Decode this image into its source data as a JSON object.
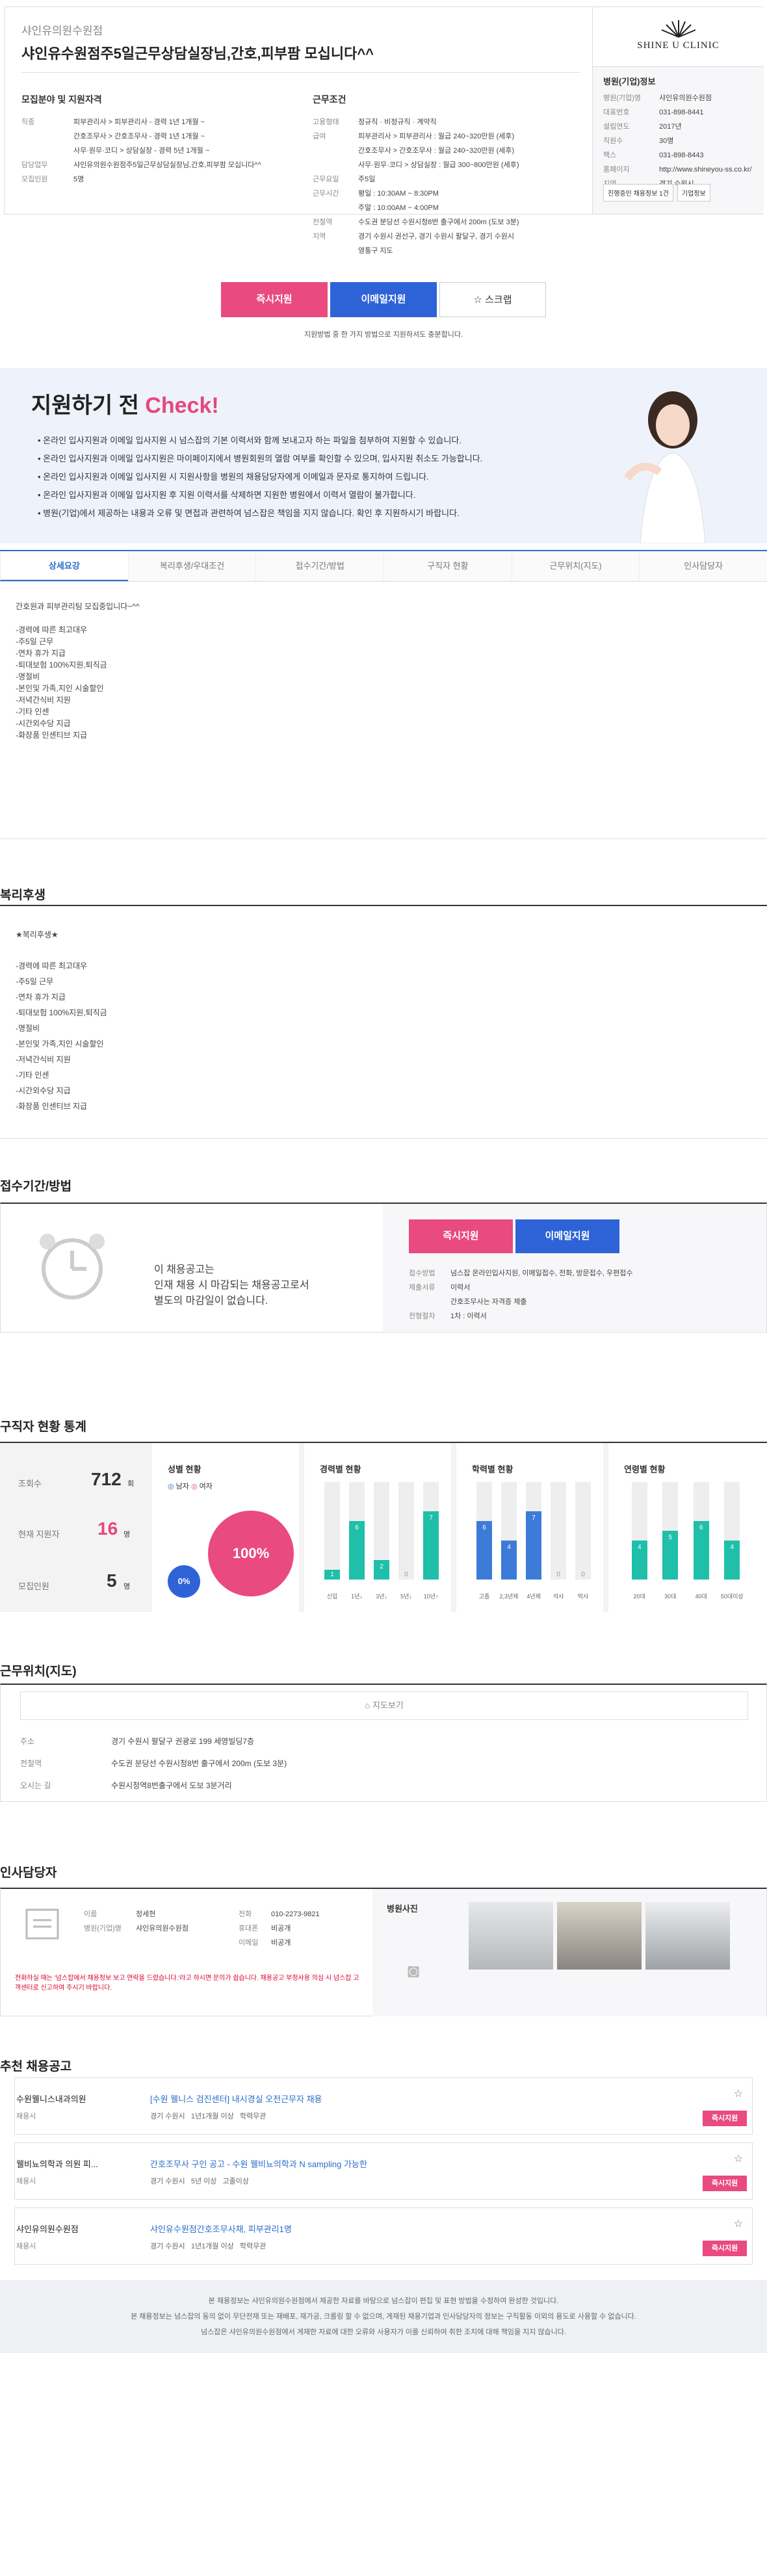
{
  "header": {
    "company": "샤인유의원수원점",
    "title": "샤인유수원점주5일근무상담실장님,간호,피부팜 모십니다^^"
  },
  "left": {
    "heading": "모집분야 및 지원자격",
    "rows": [
      {
        "k": "직종",
        "v": "피부관리사 > 피부관리사 - 경력 1년 1개월 ~"
      },
      {
        "k": "",
        "v": "간호조무사 > 간호조무사 - 경력 1년 1개월 ~"
      },
      {
        "k": "",
        "v": "사무·원무·코디 > 상담실장 - 경력 5년 1개월 ~"
      },
      {
        "k": "담당업무",
        "v": "샤인유의원수원점주5일근무상담실장님,간호,피부팜 모십니다^^"
      },
      {
        "k": "모집인원",
        "v": "5명"
      }
    ]
  },
  "right": {
    "heading": "근무조건",
    "rows": [
      {
        "k": "고용형태",
        "v": "정규직 · 비정규직 · 계약직"
      },
      {
        "k": "급여",
        "v": "피부관리사 > 피부관리사 : 월급 240~320만원 (세후)"
      },
      {
        "k": "",
        "v": "간호조무사 > 간호조무사 : 월급 240~320만원 (세후)"
      },
      {
        "k": "",
        "v": "사무·원무·코디 > 상담실장 : 월급 300~800만원 (세후)"
      },
      {
        "k": "근무요일",
        "v": "주5일"
      },
      {
        "k": "근무시간",
        "v": "평일 : 10:30AM ~ 8:30PM"
      },
      {
        "k": "",
        "v": "주말 : 10:00AM ~ 4:00PM"
      },
      {
        "k": "전철역",
        "v": "수도권 분당선 수원시청8번 출구에서 200m (도보 3분)"
      },
      {
        "k": "지역",
        "v": "경기 수원시 권선구, 경기 수원시 팔달구, 경기 수원시"
      },
      {
        "k": "",
        "v": "영통구  지도"
      }
    ]
  },
  "side": {
    "logo": "SHINE U CLINIC",
    "heading": "병원(기업)정보",
    "rows": [
      {
        "k": "병원(기업)명",
        "v": "샤인유의원수원점"
      },
      {
        "k": "대표번호",
        "v": "031-898-8441"
      },
      {
        "k": "설립연도",
        "v": "2017년"
      },
      {
        "k": "직원수",
        "v": "30명"
      },
      {
        "k": "팩스",
        "v": "031-898-8443"
      },
      {
        "k": "홈페이지",
        "v": "http://www.shineyou-ss.co.kr/"
      },
      {
        "k": "지역",
        "v": "경기 수원시"
      }
    ],
    "btn1": "진행중인 채용정보 1건",
    "btn2": "기업정보"
  },
  "apply": {
    "instant": "즉시지원",
    "email": "이메일지원",
    "scrap": "스크랩",
    "note": "지원방법 중 한 가지 방법으로 지원하셔도 충분합니다."
  },
  "check": {
    "title_a": "지원하기 전 ",
    "title_b": "Check!",
    "items": [
      "온라인 입사지원과 이메일 입사지원 시 넘스잡의 기본 이력서와 함께 보내고자 하는 파일을 첨부하여 지원할 수 있습니다.",
      "온라인 입사지원과 이메일 입사지원은 마이페이지에서 병원회원의 열람 여부를 확인할 수 있으며, 입사지원 취소도 가능합니다.",
      "온라인 입사지원과 이메일 입사지원 시 지원사항을 병원의 채용담당자에게 이메일과 문자로 통지하여 드립니다.",
      "온라인 입사지원과 이메일 입사지원 후 지원 이력서를 삭제하면 지원한 병원에서 이력서 열람이 불가합니다.",
      "병원(기업)에서 제공하는 내용과 오류 및 면접과 관련하여 넘스잡은 책임을 지지 않습니다. 확인 후 지원하시기 바랍니다."
    ]
  },
  "tabs": [
    "상세요강",
    "복리후생/우대조건",
    "접수기간/방법",
    "구직자 현황",
    "근무위치(지도)",
    "인사담당자"
  ],
  "detail": [
    "간호원과 피부관리팀 모집중입니다~^^",
    "",
    "-경력에 따른 최고대우",
    "-주5일 근무",
    "-연차 휴가 지급",
    "-퇴대보험 100%지원,퇴직금",
    "-명절비",
    "-본인및 가족,지인 시술할인",
    "-저녁간식비 지원",
    "-기타 인센",
    "-시간외수당 지급",
    "-화장품 인센티브 지급"
  ],
  "welfare": {
    "title": "복리후생",
    "lines": [
      "★복리후생★",
      "",
      "-경력에 따른 최고대우",
      "-주5일 근무",
      "-연차 휴가 지급",
      "-퇴대보험 100%지원,퇴직금",
      "-명절비",
      "-본인및 가족,지인 시술할인",
      "-저녁간식비 지원",
      "-기타 인센",
      "-시간외수당 지급",
      "-화장품 인센티브 지급"
    ]
  },
  "period": {
    "title": "접수기간/방법",
    "msg": [
      "이 채용공고는",
      "인재 채용 시 마감되는 채용공고로서",
      "별도의 마감일이 없습니다."
    ],
    "rows": [
      {
        "k": "접수방법",
        "v": "넘스잡 온라인입사지원, 이메일접수, 전화, 방문접수, 우편접수"
      },
      {
        "k": "제출서류",
        "v": "이력서"
      },
      {
        "k": "",
        "v": "간호조무사는 자격증 제출"
      },
      {
        "k": "전형절차",
        "v": "1차 : 이력서"
      }
    ]
  },
  "stats": {
    "title": "구직자 현황 통계",
    "views": "712",
    "views_unit": "회",
    "applicants": "16",
    "app_unit": "명",
    "recruit": "5",
    "rec_unit": "명",
    "views_label": "조회수",
    "app_label": "현재 지원자",
    "rec_label": "모집인원",
    "gender_title": "성별 현황",
    "male": "남자",
    "female": "여자",
    "female_pct": "100%",
    "male_pct": "0%",
    "career_title": "경력별 현황",
    "edu_title": "학력별 현황",
    "age_title": "연령별 현황"
  },
  "chart_data": [
    {
      "type": "bar",
      "title": "경력별 현황",
      "categories": [
        "신입",
        "1년↓",
        "3년↓",
        "5년↓",
        "10년↑"
      ],
      "values": [
        1,
        6,
        2,
        0,
        7
      ]
    },
    {
      "type": "bar",
      "title": "학력별 현황",
      "categories": [
        "고졸",
        "2,3년제",
        "4년제",
        "석사",
        "박사"
      ],
      "values": [
        6,
        4,
        7,
        0,
        0
      ]
    },
    {
      "type": "bar",
      "title": "연령별 현황",
      "categories": [
        "20대",
        "30대",
        "40대",
        "50대이상"
      ],
      "values": [
        4,
        5,
        6,
        4
      ]
    }
  ],
  "map": {
    "title": "근무위치(지도)",
    "btn": "지도보기",
    "rows": [
      {
        "k": "주소",
        "v": "경기 수원시 팔달구 권광로 199 세영빌딩7층"
      },
      {
        "k": "전철역",
        "v": "수도권 분당선 수원시청8번 출구에서 200m (도보 3분)"
      },
      {
        "k": "오시는 길",
        "v": "수원시청역8번출구에서 도보 3분거리"
      }
    ]
  },
  "hr": {
    "title": "인사담당자",
    "rows": [
      {
        "k": "이름",
        "v": "정세헌"
      },
      {
        "k": "병원(기업)명",
        "v": "샤인유의원수원점"
      }
    ],
    "rows2": [
      {
        "k": "전화",
        "v": "010-2273-9821"
      },
      {
        "k": "휴대폰",
        "v": "비공개"
      },
      {
        "k": "이메일",
        "v": "비공개"
      }
    ],
    "warn": "전화하실 때는 '넘스잡에서 채용정보 보고 연락을 드렸습니다.'라고 하시면 문의가 쉽습니다. 채용공고 부정사용 의심 시 넘스잡 고객센터로 신고하여 주시기 바랍니다.",
    "photos": "병원사진"
  },
  "recommend": {
    "title": "추천 채용공고",
    "items": [
      {
        "co": "수원웰니스내과의원",
        "sub": "채용시",
        "ttl": "[수원 웰니스 검진센터] 내시경실 오전근무자 채용",
        "meta": "경기 수원시   1년1개월 이상   학력무관",
        "btn": "즉시지원"
      },
      {
        "co": "웰비뇨의학과 의원 피...",
        "sub": "채용시",
        "ttl": "간호조무사 구인 공고 - 수원 웰비뇨의학과 N sampling 가능한",
        "meta": "경기 수원시   5년 이상   고졸이상",
        "btn": "즉시지원"
      },
      {
        "co": "샤인유의원수원점",
        "sub": "채용시",
        "ttl": "샤인유수원점간호조무사채, 피부관리1명",
        "meta": "경기 수원시   1년1개월 이상   학력무관",
        "btn": "즉시지원"
      }
    ]
  },
  "footer": [
    "본 채용정보는 샤인유의원수원점에서 제공한 자료를 바탕으로 넘스잡이 편집 및 표현 방법을 수정하여 완성한 것입니다.",
    "본 채용정보는 넘스잡의 동의 없이 무단전재 또는 재배포, 재가공, 크롤링 할 수 없으며, 게재된 채용기업과 인사담당자의 정보는 구직활동 이외의 용도로 사용할 수 없습니다.",
    "넘스잡은 샤인유의원수원점에서 게재한 자료에 대한 오류와 사용자가 이를 신뢰하여 취한 조치에 대해 책임을 지지 않습니다."
  ]
}
